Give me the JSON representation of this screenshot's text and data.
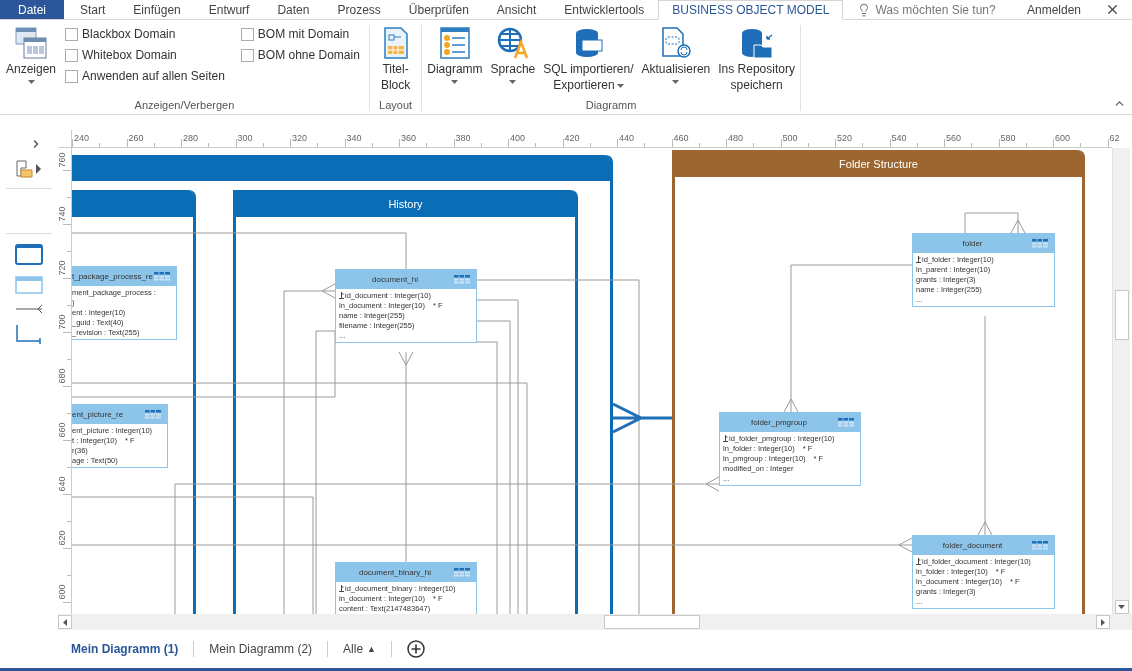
{
  "ribbon_tabs": [
    {
      "label": "Datei",
      "kind": "file",
      "selected": false
    },
    {
      "label": "Start",
      "kind": "tab",
      "selected": false
    },
    {
      "label": "Einfügen",
      "kind": "tab",
      "selected": false
    },
    {
      "label": "Entwurf",
      "kind": "tab",
      "selected": false
    },
    {
      "label": "Daten",
      "kind": "tab",
      "selected": false
    },
    {
      "label": "Prozess",
      "kind": "tab",
      "selected": false
    },
    {
      "label": "Überprüfen",
      "kind": "tab",
      "selected": false
    },
    {
      "label": "Ansicht",
      "kind": "tab",
      "selected": false
    },
    {
      "label": "Entwicklertools",
      "kind": "tab",
      "selected": false
    },
    {
      "label": "BUSINESS OBJECT MODEL",
      "kind": "tab",
      "selected": true
    }
  ],
  "tell_me": {
    "placeholder": "Was möchten Sie tun?"
  },
  "account": "Anmelden",
  "ribbon": {
    "show_hide": {
      "button": {
        "lines": [
          "Anzeigen"
        ],
        "dropdown": true
      },
      "checkboxes": [
        {
          "label": "Blackbox Domain",
          "checked": false
        },
        {
          "label": "Whitebox Domain",
          "checked": false
        },
        {
          "label": "Anwenden auf allen Seiten",
          "checked": false
        },
        {
          "label": "BOM mit Domain",
          "checked": false
        },
        {
          "label": "BOM ohne Domain",
          "checked": false
        }
      ],
      "label": "Anzeigen/Verbergen"
    },
    "layout": {
      "buttons": [
        {
          "lines": [
            "Titel-",
            "Block"
          ],
          "dropdown": false
        }
      ],
      "label": "Layout"
    },
    "diagram": {
      "buttons": [
        {
          "lines": [
            "Diagramm"
          ],
          "dropdown": true
        },
        {
          "lines": [
            "Sprache"
          ],
          "dropdown": true
        },
        {
          "lines": [
            "SQL importieren/",
            "Exportieren"
          ],
          "dropdown": true
        },
        {
          "lines": [
            "Aktualisieren"
          ],
          "dropdown": true
        },
        {
          "lines": [
            "Ins Repository",
            "speichern"
          ],
          "dropdown": false
        }
      ],
      "label": "Diagramm"
    }
  },
  "ruler": {
    "x_labels": [
      "240",
      "260",
      "280",
      "300",
      "320",
      "340",
      "360",
      "380",
      "400",
      "420",
      "440",
      "460",
      "480",
      "500",
      "520",
      "540",
      "560",
      "580",
      "600",
      "62"
    ],
    "y_labels": [
      "760",
      "740",
      "720",
      "700",
      "680",
      "660",
      "640",
      "620",
      "600"
    ]
  },
  "containers": [
    {
      "color": "#0b6db5"
    },
    {
      "color": "#0b6db5"
    },
    {
      "title": "History",
      "color": "#0b6db5"
    },
    {
      "title": "Folder Structure",
      "color": "#9c6631"
    }
  ],
  "entities": [
    {
      "title": "t_package_process_re",
      "rows": [
        {
          "text": "ment_package_process :",
          "key": false
        },
        {
          "text": ")",
          "key": false
        },
        {
          "text": "ent : Integer(10)",
          "key": false
        },
        {
          "text": "_guid : Text(40)",
          "key": false
        },
        {
          "text": "_revision : Text(255)",
          "key": false
        }
      ]
    },
    {
      "title": "ent_picture_re",
      "rows": [
        {
          "text": "ent_picture : Integer(10)",
          "key": false
        },
        {
          "text": "t : Integer(10)",
          "suffix": "* F",
          "key": false
        },
        {
          "text": "r(36)",
          "key": false
        },
        {
          "text": "age : Text(50)",
          "key": false
        }
      ]
    },
    {
      "title": "document_hi",
      "rows": [
        {
          "text": "id_document : Integer(10)",
          "key": true
        },
        {
          "text": "ln_document : Integer(10)",
          "suffix": "* F",
          "key": false
        },
        {
          "text": "name : Integer(255)",
          "key": false
        },
        {
          "text": "filename : Integer(255)",
          "key": false
        },
        {
          "text": "...",
          "key": false
        }
      ]
    },
    {
      "title": "document_binary_hi",
      "rows": [
        {
          "text": "id_document_binary : Integer(10)",
          "key": true
        },
        {
          "text": "ln_document : Integer(10)",
          "suffix": "* F",
          "key": false
        },
        {
          "text": "content : Text(2147483647)",
          "key": false
        }
      ]
    },
    {
      "title": "folder",
      "rows": [
        {
          "text": "id_folder : Integer(10)",
          "key": true
        },
        {
          "text": "ln_parent : Integer(10)",
          "key": false
        },
        {
          "text": "grants : Integer(3)",
          "key": false
        },
        {
          "text": "name : Integer(255)",
          "key": false
        },
        {
          "text": "...",
          "key": false
        }
      ]
    },
    {
      "title": "folder_pmgroup",
      "rows": [
        {
          "text": "id_folder_pmgroup : Integer(10)",
          "key": true
        },
        {
          "text": "ln_folder : Integer(10)",
          "suffix": "* F",
          "key": false
        },
        {
          "text": "ln_pmgroup : Integer(10)",
          "suffix": "* F",
          "key": false
        },
        {
          "text": "modified_on : Integer",
          "key": false
        },
        {
          "text": "...",
          "key": false
        }
      ]
    },
    {
      "title": "folder_document",
      "rows": [
        {
          "text": "id_folder_document : Integer(10)",
          "key": true
        },
        {
          "text": "ln_folder : Integer(10)",
          "suffix": "* F",
          "key": false
        },
        {
          "text": "ln_document : Integer(10)",
          "suffix": "* F",
          "key": false
        },
        {
          "text": "grants : Integer(3)",
          "key": false
        },
        {
          "text": "...",
          "key": false
        }
      ]
    }
  ],
  "page_tabs": [
    {
      "label": "Mein Diagramm (1)",
      "selected": true
    },
    {
      "label": "Mein Diagramm (2)",
      "selected": false
    }
  ],
  "all_pages": {
    "label": "Alle",
    "arrow": "▲"
  }
}
